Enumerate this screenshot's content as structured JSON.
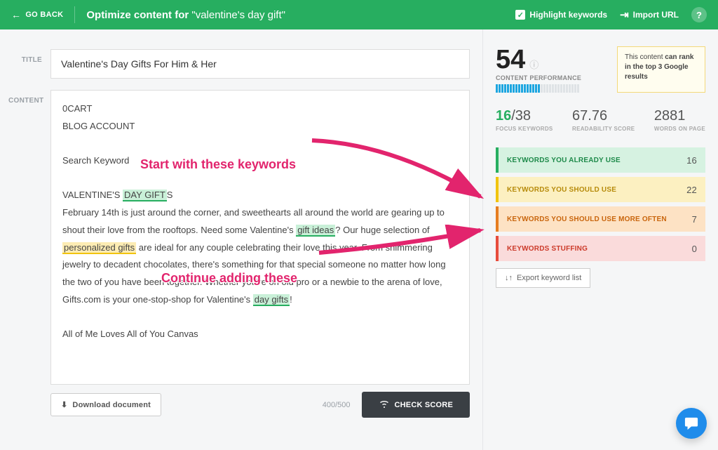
{
  "header": {
    "go_back": "GO BACK",
    "title_prefix": "Optimize content for",
    "title_query": "\"valentine's day gift\"",
    "highlight_keywords": "Highlight keywords",
    "import_url": "Import URL"
  },
  "editor": {
    "title_label": "TITLE",
    "content_label": "CONTENT",
    "title_value": "Valentine's Day Gifts For Him & Her",
    "body": {
      "line1": "0CART",
      "line2": "BLOG ACCOUNT",
      "line3": "Search Keyword",
      "line4_pre": "VALENTINE'S ",
      "line4_hl": "DAY GIFT",
      "line4_post": "S",
      "para1_a": "February 14th is just around the corner, and sweethearts all around the world are gearing up to shout their love from the rooftops. Need some Valentine's ",
      "para1_hl1": "gift ideas",
      "para1_b": "? Our huge selection of ",
      "para1_hl2": "personalized gifts",
      "para1_c": " are ideal for any couple celebrating their love this year. From shimmering jewelry to decadent chocolates, there's something for that special someone no matter how long the two of you have been together. Whether you're on old pro or a newbie to the arena of love, Gifts.com is your one-stop-shop for Valentine's ",
      "para1_hl3": "day gifts",
      "para1_d": "!",
      "line5": " All of Me Loves All of You Canvas"
    },
    "download": "Download document",
    "word_count": "400/500",
    "check_score": "CHECK SCORE"
  },
  "sidebar": {
    "score": "54",
    "cp_label": "CONTENT PERFORMANCE",
    "rank_pre": "This content ",
    "rank_bold": "can rank in the top 3 Google results",
    "metrics": {
      "focus_used": "16",
      "focus_total": "/38",
      "focus_label": "FOCUS KEYWORDS",
      "readability": "67.76",
      "readability_label": "READABILITY SCORE",
      "words": "2881",
      "words_label": "WORDS ON PAGE"
    },
    "kw": {
      "already": {
        "label": "KEYWORDS YOU ALREADY USE",
        "count": "16"
      },
      "should": {
        "label": "KEYWORDS YOU SHOULD USE",
        "count": "22"
      },
      "more": {
        "label": "KEYWORDS YOU SHOULD USE MORE OFTEN",
        "count": "7"
      },
      "stuffing": {
        "label": "KEYWORDS STUFFING",
        "count": "0"
      }
    },
    "export": "Export keyword list"
  },
  "annotations": {
    "start": "Start with these keywords",
    "continue": "Continue adding these"
  }
}
